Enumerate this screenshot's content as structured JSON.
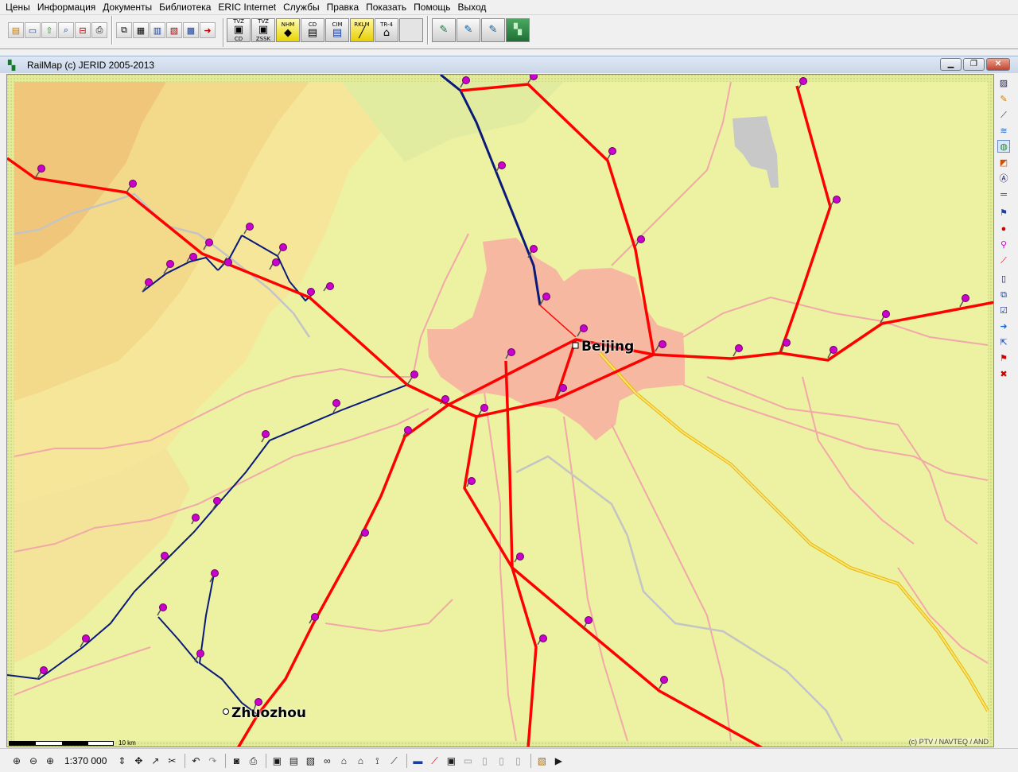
{
  "menu": [
    {
      "label": "Цены"
    },
    {
      "label": "Информация"
    },
    {
      "label": "Документы"
    },
    {
      "label": "Библиотека"
    },
    {
      "label": "ERIC Internet"
    },
    {
      "label": "Службы"
    },
    {
      "label": "Правка"
    },
    {
      "label": "Показать"
    },
    {
      "label": "Помощь"
    },
    {
      "label": "Выход"
    }
  ],
  "toolbar": {
    "small_icons": [
      "new-document-icon",
      "card-icon",
      "upload-icon",
      "search-route-icon",
      "train-icon",
      "print-icon",
      "copy-icon",
      "document-icon",
      "table-icon",
      "grid-icon",
      "calendar-icon",
      "exit-icon"
    ],
    "big_buttons": [
      {
        "top": "TVZ",
        "bottom": "CD"
      },
      {
        "top": "TVZ",
        "bottom": "ZSSK"
      },
      {
        "top": "NHM",
        "bottom": ""
      },
      {
        "top": "CD",
        "bottom": ""
      },
      {
        "top": "CIM",
        "bottom": ""
      },
      {
        "top": "RKLM",
        "bottom": ""
      },
      {
        "top": "TR-4",
        "bottom": ""
      },
      {
        "top": "",
        "bottom": ""
      }
    ],
    "extra_icons": [
      "edit-form-icon",
      "edit-form-icon",
      "edit-form-icon",
      "railmap-icon"
    ]
  },
  "window": {
    "title": "RailMap (c) JERID 2005-2013",
    "minimize": "▁",
    "restore": "❐",
    "close": "✕"
  },
  "map": {
    "cities": [
      {
        "name": "Beijing"
      },
      {
        "name": "Zhuozhou"
      }
    ],
    "copyright": "(c) PTV / NAVTEQ / AND",
    "scale_bar_label": "10 km",
    "colors": {
      "background": "#eef3b0",
      "urban": "#f6b8a0",
      "main_rail": "#ff0000",
      "secondary_rail": "#0a1a7a",
      "roads": "#f2a8a8",
      "highway": "#ffe37a",
      "station_pin": "#cc00cc"
    }
  },
  "right_toolbar": [
    "hatch-icon",
    "pencil-icon",
    "chart-icon",
    "layers-icon",
    "globe-icon",
    "paint-icon",
    "text-icon",
    "ruler-icon",
    "flag-icon",
    "pin-icon",
    "pin-edit-icon",
    "route-icon",
    "page-icon",
    "copy-icon",
    "check-icon",
    "forward-icon",
    "share-icon",
    "flag-red-icon",
    "delete-icon"
  ],
  "status": {
    "scale": "1:370 000"
  }
}
